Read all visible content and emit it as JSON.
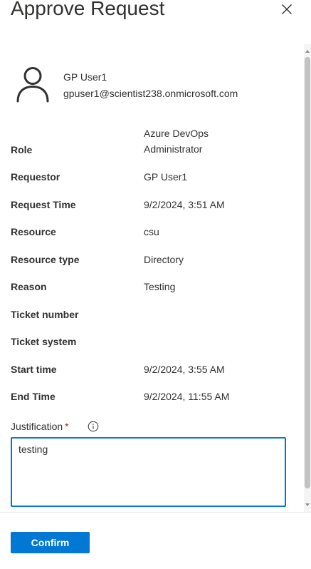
{
  "panel": {
    "title": "Approve Request"
  },
  "user": {
    "name": "GP User1",
    "email": "gpuser1@scientist238.onmicrosoft.com"
  },
  "details": [
    {
      "label": "Role",
      "value": "Azure DevOps Administrator"
    },
    {
      "label": "Requestor",
      "value": "GP User1"
    },
    {
      "label": "Request Time",
      "value": "9/2/2024, 3:51 AM"
    },
    {
      "label": "Resource",
      "value": "csu"
    },
    {
      "label": "Resource type",
      "value": "Directory"
    },
    {
      "label": "Reason",
      "value": "Testing"
    },
    {
      "label": "Ticket number",
      "value": ""
    },
    {
      "label": "Ticket system",
      "value": ""
    },
    {
      "label": "Start time",
      "value": "9/2/2024, 3:55 AM"
    },
    {
      "label": "End Time",
      "value": "9/2/2024, 11:55 AM"
    }
  ],
  "justification": {
    "label": "Justification",
    "required_mark": "*",
    "value": "testing"
  },
  "footer": {
    "confirm_label": "Confirm"
  },
  "colors": {
    "accent": "#0078d4",
    "required": "#a4262c"
  }
}
